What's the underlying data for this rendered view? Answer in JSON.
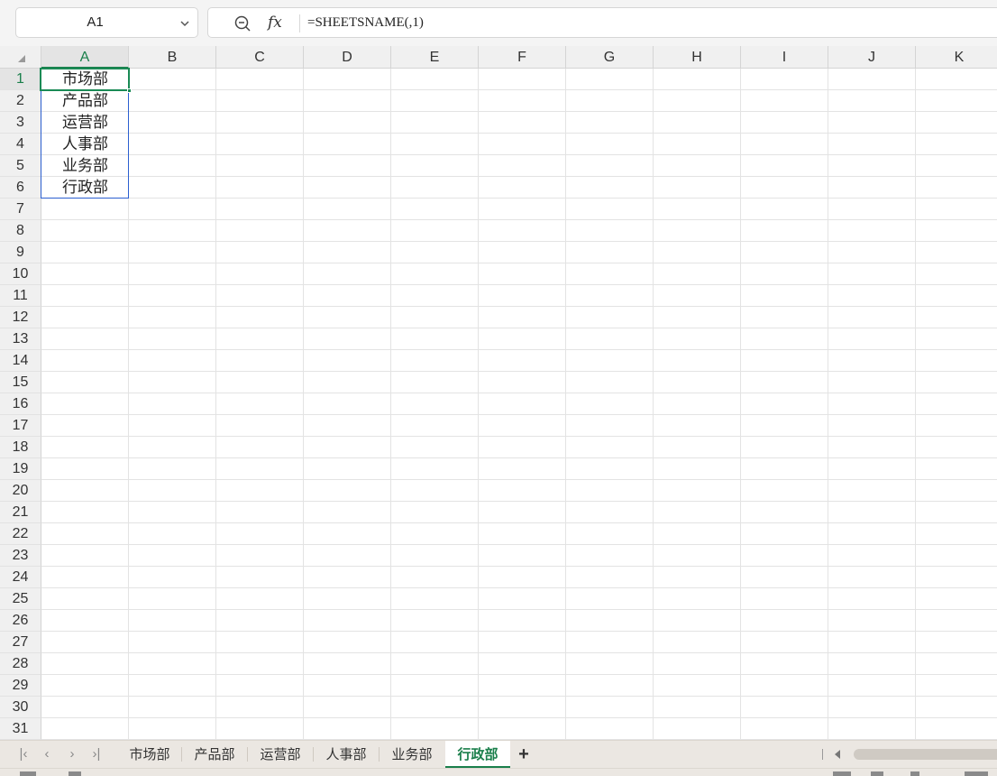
{
  "formula_bar": {
    "name_box": "A1",
    "formula": "=SHEETSNAME(,1)"
  },
  "columns": [
    "A",
    "B",
    "C",
    "D",
    "E",
    "F",
    "G",
    "H",
    "I",
    "J",
    "K"
  ],
  "active_column": "A",
  "rows": [
    "1",
    "2",
    "3",
    "4",
    "5",
    "6",
    "7",
    "8",
    "9",
    "10",
    "11",
    "12",
    "13",
    "14",
    "15",
    "16",
    "17",
    "18",
    "19",
    "20",
    "21",
    "22",
    "23",
    "24",
    "25",
    "26",
    "27",
    "28",
    "29",
    "30",
    "31"
  ],
  "active_row": "1",
  "cells": {
    "A1": "市场部",
    "A2": "产品部",
    "A3": "运营部",
    "A4": "人事部",
    "A5": "业务部",
    "A6": "行政部"
  },
  "sheet_tabs": [
    "市场部",
    "产品部",
    "运营部",
    "人事部",
    "业务部",
    "行政部"
  ],
  "active_sheet": "行政部",
  "colors": {
    "accent": "#1a7f4b",
    "selection_border": "#2b5fd0"
  }
}
